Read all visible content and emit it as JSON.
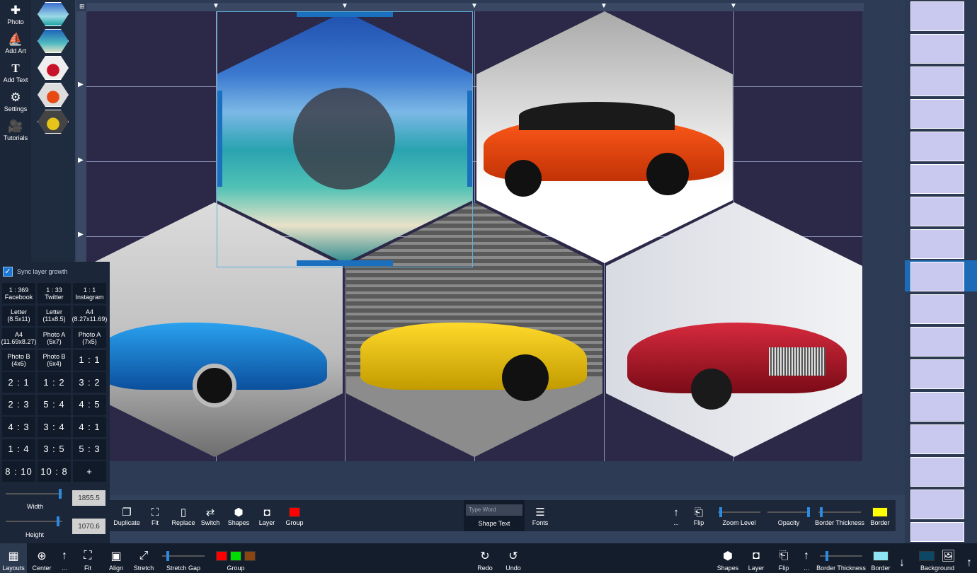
{
  "left_tools": [
    {
      "label": "Photo",
      "icon": "add-photo-icon"
    },
    {
      "label": "Add Art",
      "icon": "sailboat-icon"
    },
    {
      "label": "Add Text",
      "icon": "text-icon"
    },
    {
      "label": "Settings",
      "icon": "gear-icon"
    },
    {
      "label": "Tutorials",
      "icon": "camera-icon"
    }
  ],
  "ratio_panel": {
    "sync_label": "Sync layer growth",
    "sync_checked": true,
    "buttons": [
      "1 : 369\nFacebook",
      "1 : 33\nTwitter",
      "1 : 1\nInstagram",
      "Letter\n(8.5x11)",
      "Letter\n(11x8.5)",
      "A4\n(8.27x11.69)",
      "A4\n(11.69x8.27)",
      "Photo A\n(5x7)",
      "Photo A\n(7x5)",
      "Photo B\n(4x6)",
      "Photo B\n(6x4)",
      "1 : 1",
      "2 : 1",
      "1 : 2",
      "3 : 2",
      "2 : 3",
      "5 : 4",
      "4 : 5",
      "4 : 3",
      "3 : 4",
      "4 : 1",
      "1 : 4",
      "3 : 5",
      "5 : 3",
      "8 : 10",
      "10 : 8",
      "+"
    ],
    "width_label": "Width",
    "width_value": "1855.5",
    "height_label": "Height",
    "height_value": "1070.6"
  },
  "toolbar": {
    "left": [
      "Duplicate",
      "Fit",
      "Replace",
      "Switch",
      "Shapes",
      "Layer",
      "Group"
    ],
    "shape_text_placeholder": "Type Word",
    "shape_text_label": "Shape Text",
    "fonts_label": "Fonts",
    "more_label": "...",
    "flip_label": "Flip",
    "zoom_label": "Zoom Level",
    "opacity_label": "Opacity",
    "border_thickness_label": "Border Thickness",
    "border_label": "Border",
    "group_color": "#ff0000",
    "border_color": "#ffff00"
  },
  "bottombar": {
    "left": [
      "Layouts",
      "Center",
      "...",
      "Fit",
      "Align",
      "Stretch",
      "Stretch Gap",
      "Group"
    ],
    "group_colors": [
      "#ff0000",
      "#00dd00",
      "#8b4513"
    ],
    "redo_label": "Redo",
    "undo_label": "Undo",
    "right": [
      "Shapes",
      "Layer",
      "Flip",
      "...",
      "Border Thickness",
      "Border",
      "Background"
    ],
    "border_color": "#8ee4f2",
    "background_color": "#0c4866"
  }
}
